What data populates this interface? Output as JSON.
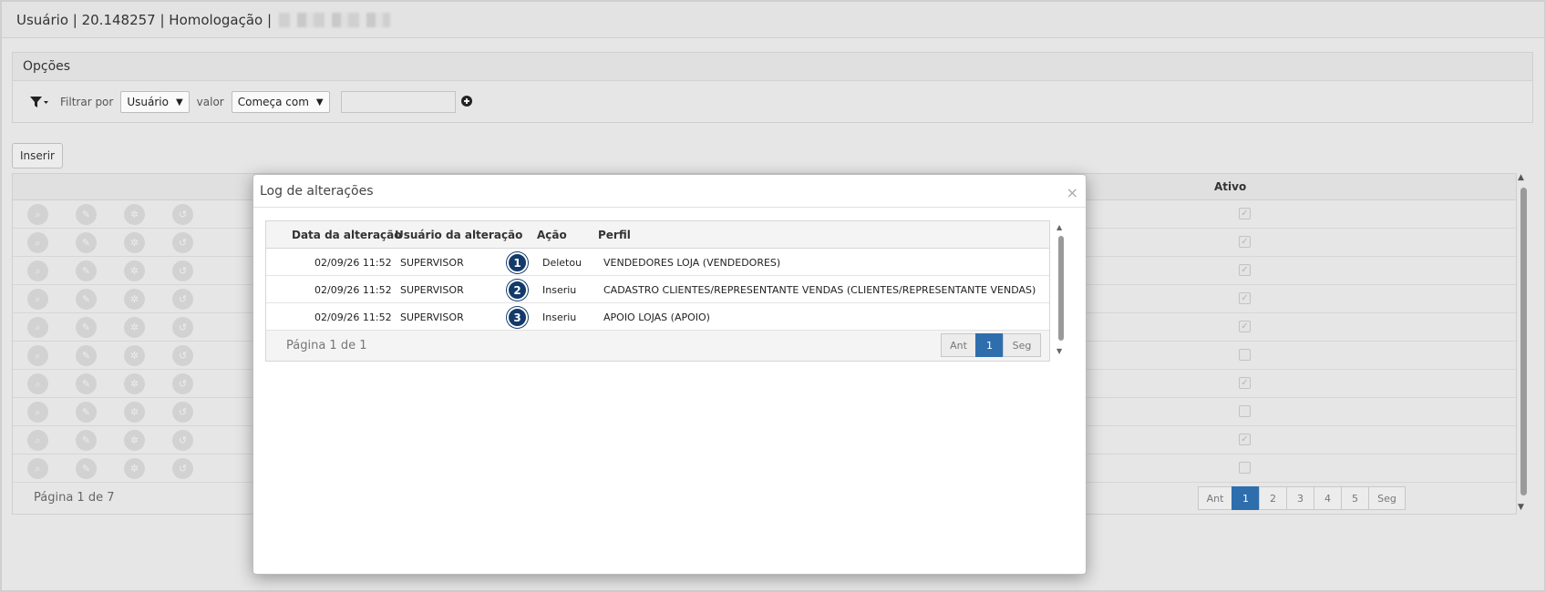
{
  "header": {
    "title": "Usuário | 20.148257 | Homologação |"
  },
  "options": {
    "title": "Opções",
    "filter_label": "Filtrar por",
    "filter_field": "Usuário",
    "value_label": "valor",
    "value_operator": "Começa com",
    "value_input": ""
  },
  "toolbar": {
    "insert_label": "Inserir"
  },
  "bg_table": {
    "col_ativo": "Ativo",
    "rows": [
      {
        "ativo": true
      },
      {
        "ativo": true
      },
      {
        "ativo": true
      },
      {
        "ativo": true
      },
      {
        "ativo": true
      },
      {
        "ativo": false
      },
      {
        "ativo": true
      },
      {
        "ativo": false
      },
      {
        "ativo": true
      },
      {
        "ativo": false
      }
    ],
    "page_label": "Página 1 de 7",
    "pager": {
      "prev": "Ant",
      "pages": [
        "1",
        "2",
        "3",
        "4",
        "5"
      ],
      "active": "1",
      "next": "Seg"
    }
  },
  "modal": {
    "title": "Log de alterações",
    "close": "×",
    "columns": {
      "data": "Data da alteração",
      "usuario": "Usuário da alteração",
      "acao": "Ação",
      "perfil": "Perfil"
    },
    "rows": [
      {
        "num": "1",
        "data": "02/09/26 11:52",
        "usuario": "SUPERVISOR",
        "acao": "Deletou",
        "perfil": "VENDEDORES LOJA (VENDEDORES)"
      },
      {
        "num": "2",
        "data": "02/09/26 11:52",
        "usuario": "SUPERVISOR",
        "acao": "Inseriu",
        "perfil": "CADASTRO CLIENTES/REPRESENTANTE VENDAS (CLIENTES/REPRESENTANTE VENDAS)"
      },
      {
        "num": "3",
        "data": "02/09/26 11:52",
        "usuario": "SUPERVISOR",
        "acao": "Inseriu",
        "perfil": "APOIO LOJAS (APOIO)"
      }
    ],
    "page_label": "Página 1 de 1",
    "pager": {
      "prev": "Ant",
      "active": "1",
      "next": "Seg"
    }
  },
  "icons": {
    "filter": "filter-icon",
    "add": "plus-circle-icon",
    "row_actions": [
      "search-icon",
      "pencil-icon",
      "gear-icon",
      "history-icon"
    ]
  },
  "colors": {
    "accent": "#2f6ead",
    "badge": "#123a6a"
  }
}
